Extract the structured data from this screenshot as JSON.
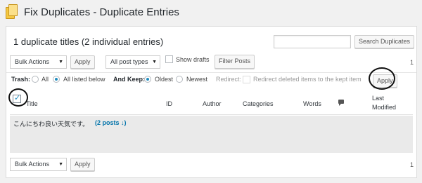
{
  "header": {
    "title": "Fix Duplicates - Duplicate Entries",
    "icon": "pages-icon"
  },
  "summary": "1 duplicate titles (2 individual entries)",
  "search": {
    "value": "",
    "button_label": "Search Duplicates"
  },
  "top_bar": {
    "bulk_actions": "Bulk Actions",
    "apply_label": "Apply",
    "post_types": "All post types",
    "show_drafts_label": "Show drafts",
    "filter_label": "Filter Posts",
    "page": "1"
  },
  "options": {
    "trash_label": "Trash:",
    "trash_all": "All",
    "trash_listed": "All listed below",
    "keep_label": "And Keep:",
    "keep_oldest": "Oldest",
    "keep_newest": "Newest",
    "redirect_label": "Redirect:",
    "redirect_text": "Redirect deleted items to the kept item",
    "apply_label": "Apply"
  },
  "table": {
    "columns": [
      "Title",
      "ID",
      "Author",
      "Categories",
      "Words",
      "",
      "Last",
      "Modified"
    ],
    "rows": [
      {
        "title": "こんにちわ良い天気です。",
        "link": "(2 posts ↓)"
      }
    ]
  },
  "bottom_bar": {
    "bulk_actions": "Bulk Actions",
    "apply_label": "Apply",
    "page": "1"
  },
  "colors": {
    "accent": "#1e8cbe",
    "link": "#0073aa"
  }
}
